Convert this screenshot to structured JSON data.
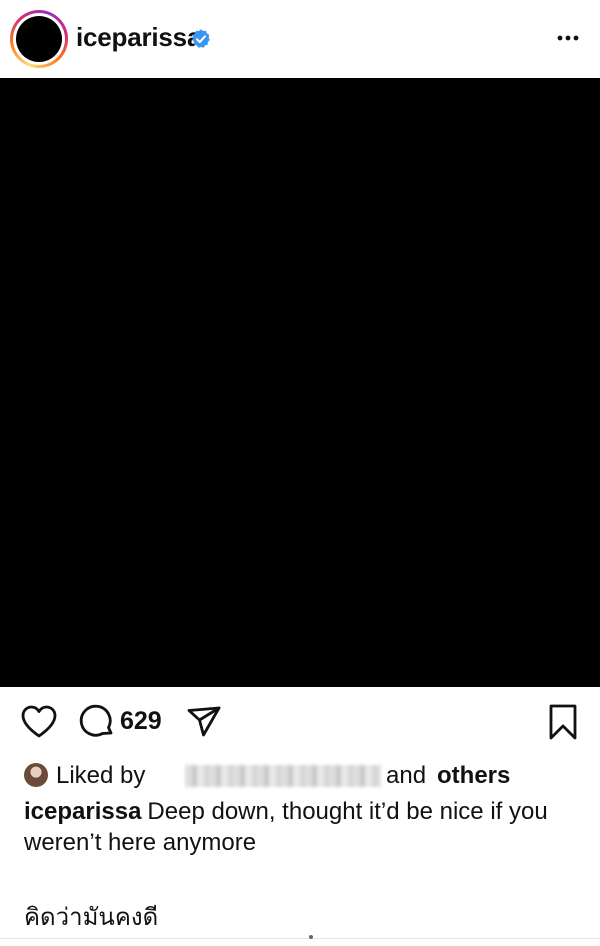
{
  "post": {
    "username": "iceparissa",
    "verified": true,
    "media_color": "#000000",
    "comment_count": "629",
    "liked_by_prefix": "Liked by",
    "liked_by_conjunction": "and",
    "liked_by_others": "others",
    "caption_text": "Deep down, thought it’d be nice if you weren’t here anymore",
    "thai_text": "คิดว่ามันคงดี"
  },
  "icons": {
    "header": [
      "more-options-icon",
      "verified-badge-icon"
    ],
    "actions": [
      "heart-icon",
      "comment-icon",
      "share-icon",
      "bookmark-icon"
    ]
  },
  "colors": {
    "verified_blue": "#3897f0",
    "text": "#111111",
    "background": "#ffffff"
  }
}
